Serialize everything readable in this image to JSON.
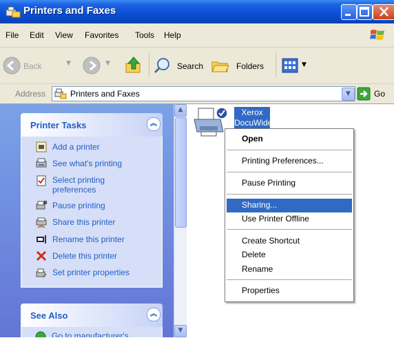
{
  "window": {
    "title": "Printers and Faxes"
  },
  "menu": [
    "File",
    "Edit",
    "View",
    "Favorites",
    "Tools",
    "Help"
  ],
  "toolbar": {
    "back": "Back",
    "search": "Search",
    "folders": "Folders"
  },
  "address": {
    "label": "Address",
    "value": "Printers and Faxes",
    "go": "Go"
  },
  "printer_tasks": {
    "title": "Printer Tasks",
    "items": [
      {
        "label": "Add a printer",
        "icon": "add-printer-icon"
      },
      {
        "label": "See what's printing",
        "icon": "print-queue-icon"
      },
      {
        "label": "Select printing",
        "label2": "preferences",
        "icon": "preferences-icon"
      },
      {
        "label": "Pause printing",
        "icon": "pause-printer-icon"
      },
      {
        "label": "Share this printer",
        "icon": "share-printer-icon"
      },
      {
        "label": "Rename this printer",
        "icon": "rename-icon"
      },
      {
        "label": "Delete this printer",
        "icon": "delete-icon"
      },
      {
        "label": "Set printer properties",
        "icon": "properties-icon"
      }
    ]
  },
  "see_also": {
    "title": "See Also",
    "partial_item": "Go to manufacturer's"
  },
  "printer": {
    "name_line1": "Xerox",
    "name_line2": "DocuWide"
  },
  "context_menu": {
    "items": [
      {
        "label": "Open",
        "bold": true
      },
      {
        "label": "Printing Preferences..."
      },
      {
        "label": "Pause Printing"
      },
      {
        "label": "Sharing...",
        "highlighted": true
      },
      {
        "label": "Use Printer Offline"
      },
      {
        "label": "Create Shortcut"
      },
      {
        "label": "Delete"
      },
      {
        "label": "Rename"
      },
      {
        "label": "Properties"
      }
    ]
  },
  "colors": {
    "title_bar": "#0a4fd3",
    "task_link": "#215dc6",
    "highlight": "#316ac5",
    "menu_bg": "#ece9d8"
  }
}
